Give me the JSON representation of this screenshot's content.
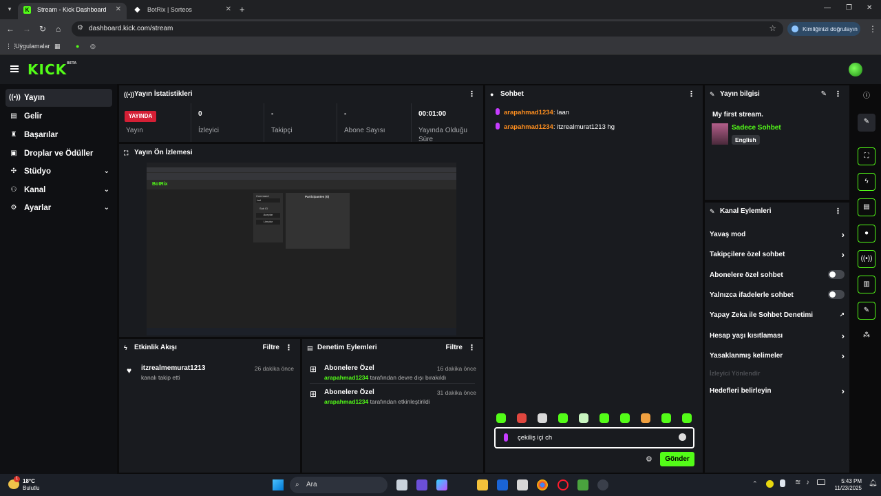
{
  "browser": {
    "tabs": [
      {
        "label": "Stream - Kick Dashboard",
        "active": true
      },
      {
        "label": "BotRix | Sorteos",
        "active": false
      }
    ],
    "url": "dashboard.kick.com/stream",
    "verify_label": "Kimliğinizi doğrulayın",
    "bookmarks": [
      {
        "label": "Uygulamalar"
      }
    ]
  },
  "brand": {
    "logo": "KICK",
    "beta": "BETA",
    "accent": "#53fc18"
  },
  "sidebar": {
    "items": [
      {
        "label": "Yayın",
        "icon": "broadcast-icon",
        "active": true
      },
      {
        "label": "Gelir",
        "icon": "revenue-icon"
      },
      {
        "label": "Başarılar",
        "icon": "trophy-icon"
      },
      {
        "label": "Droplar ve Ödüller",
        "icon": "gift-icon"
      },
      {
        "label": "Stüdyo",
        "icon": "studio-icon",
        "expandable": true
      },
      {
        "label": "Kanal",
        "icon": "users-icon",
        "expandable": true
      },
      {
        "label": "Ayarlar",
        "icon": "gear-icon",
        "expandable": true
      }
    ]
  },
  "stats_panel": {
    "title": "Yayın İstatistikleri",
    "live_badge": "YAYINDA",
    "stats": [
      {
        "value": "",
        "label": "Yayın"
      },
      {
        "value": "0",
        "label": "İzleyici"
      },
      {
        "value": "-",
        "label": "Takipçi"
      },
      {
        "value": "-",
        "label": "Abone Sayısı"
      },
      {
        "value": "00:01:00",
        "label": "Yayında Olduğu Süre"
      }
    ]
  },
  "preview_panel": {
    "title": "Yayın Ön İzlemesi",
    "inner": {
      "logo": "BotRix",
      "participants_label": "Participantes (0)",
      "command_label": "Command",
      "command_value": "!sal",
      "sub_label": "Sub ID",
      "btn1": "Aceptar",
      "btn2": "Limpiar"
    }
  },
  "activity_panel": {
    "title": "Etkinlik Akışı",
    "filter": "Filtre",
    "events": [
      {
        "user": "itzrealmemurat1213",
        "text": "kanalı takip etti",
        "time": "26 dakika önce"
      }
    ]
  },
  "moderation_panel": {
    "title": "Denetim Eylemleri",
    "filter": "Filtre",
    "events": [
      {
        "title": "Abonelere Özel",
        "user": "arapahmad1234",
        "text": "tarafından devre dışı bırakıldı",
        "time": "16 dakika önce"
      },
      {
        "title": "Abonelere Özel",
        "user": "arapahmad1234",
        "text": "tarafından etkinleştirildi",
        "time": "31 dakika önce"
      }
    ]
  },
  "chat_panel": {
    "title": "Sohbet",
    "messages": [
      {
        "user": "arapahmad1234",
        "text": ": laan"
      },
      {
        "user": "arapahmad1234",
        "text": ": itzrealmurat1213 hg"
      }
    ],
    "input_value": "çekiliş içi ch",
    "send_label": "Gönder"
  },
  "stream_info": {
    "title": "Yayın bilgisi",
    "stream_title": "My first stream.",
    "category": "Sadece Sohbet",
    "language": "English"
  },
  "channel_actions": {
    "title": "Kanal Eylemleri",
    "items": [
      {
        "label": "Yavaş mod",
        "control": "chevron"
      },
      {
        "label": "Takipçilere özel sohbet",
        "control": "chevron"
      },
      {
        "label": "Abonelere özel sohbet",
        "control": "toggle",
        "on": false
      },
      {
        "label": "Yalnızca ifadelerle sohbet",
        "control": "toggle",
        "on": false
      },
      {
        "label": "Yapay Zeka ile Sohbet Denetimi",
        "control": "external"
      },
      {
        "label": "Hesap yaşı kısıtlaması",
        "control": "chevron"
      },
      {
        "label": "Yasaklanmış kelimeler",
        "control": "chevron"
      },
      {
        "label": "İzleyici Yönlendir",
        "control": "none",
        "disabled": true
      },
      {
        "label": "Hedefleri belirleyin",
        "control": "chevron"
      }
    ]
  },
  "taskbar": {
    "weather_temp": "18°C",
    "weather_text": "Bulutlu",
    "search_label": "Ara",
    "time": "5:43 PM",
    "date": "11/23/2025",
    "notification_count": "1"
  }
}
